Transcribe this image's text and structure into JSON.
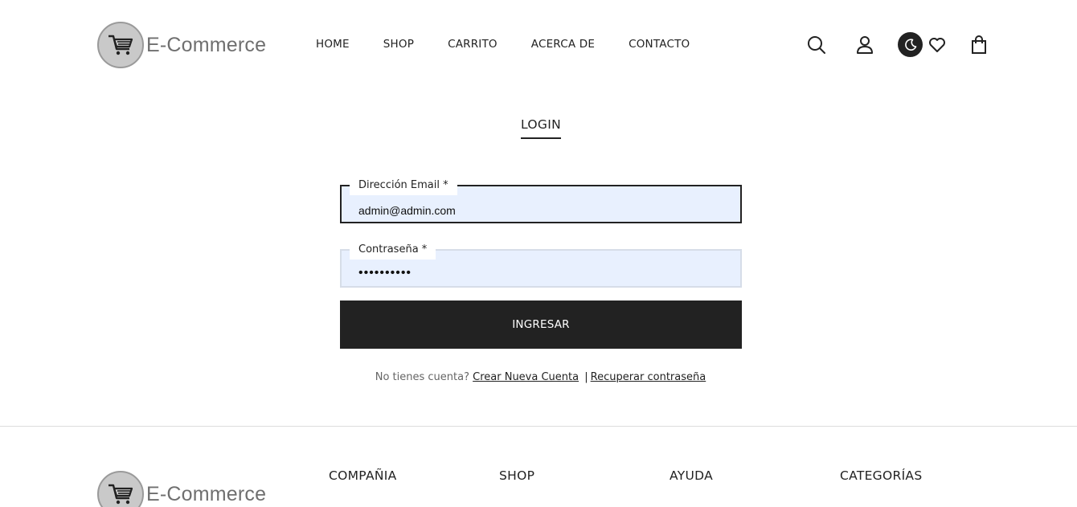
{
  "brand": {
    "name": "E-Commerce"
  },
  "nav": {
    "items": [
      "HOME",
      "SHOP",
      "CARRITO",
      "ACERCA DE",
      "CONTACTO"
    ]
  },
  "header_icons": [
    "search-icon",
    "user-icon",
    "moon-icon",
    "heart-icon",
    "bag-icon"
  ],
  "login": {
    "title": "LOGIN",
    "email_label": "Dirección Email *",
    "email_value": "admin@admin.com",
    "password_label": "Contraseña *",
    "password_value": "••••••••••",
    "submit_label": "INGRESAR",
    "no_account_text": "No tienes cuenta?",
    "create_account_link": "Crear Nueva Cuenta",
    "separator": "|",
    "recover_link": "Recuperar contraseña"
  },
  "footer": {
    "columns": [
      "COMPAÑIA",
      "SHOP",
      "AYUDA",
      "CATEGORÍAS"
    ]
  },
  "colors": {
    "dark": "#222222",
    "input_bg": "#e8f0fe",
    "logo_grey": "#6f6f6f"
  }
}
